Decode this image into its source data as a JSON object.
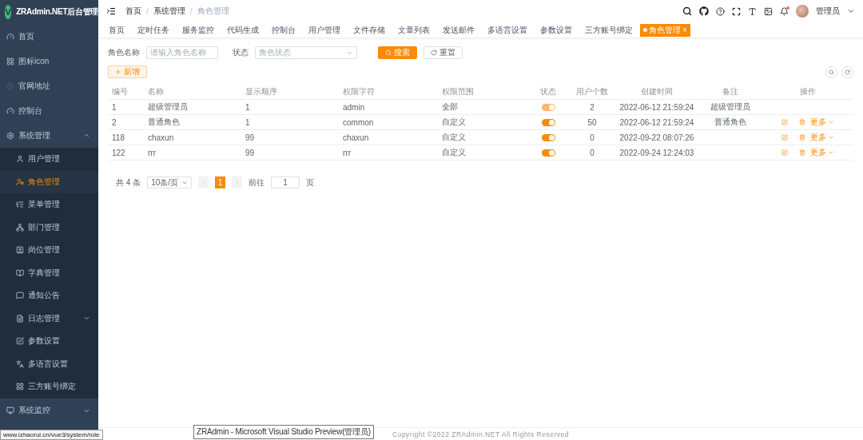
{
  "app": {
    "title": "ZRAdmin.NET后台管理",
    "logo_letter": "V"
  },
  "sidebar": {
    "items": [
      {
        "label": "首页",
        "selected": false
      },
      {
        "label": "图标icon",
        "selected": false
      },
      {
        "label": "官网地址",
        "selected": false
      },
      {
        "label": "控制台",
        "selected": false
      },
      {
        "label": "系统管理",
        "selected": false,
        "expanded": true,
        "children": [
          {
            "label": "用户管理",
            "selected": false
          },
          {
            "label": "角色管理",
            "selected": true
          },
          {
            "label": "菜单管理",
            "selected": false
          },
          {
            "label": "部门管理",
            "selected": false
          },
          {
            "label": "岗位管理",
            "selected": false
          },
          {
            "label": "字典管理",
            "selected": false
          },
          {
            "label": "通知公告",
            "selected": false
          },
          {
            "label": "日志管理",
            "selected": false,
            "expanded": false
          },
          {
            "label": "参数设置",
            "selected": false
          },
          {
            "label": "多语言设置",
            "selected": false
          },
          {
            "label": "三方账号绑定",
            "selected": false
          }
        ]
      },
      {
        "label": "系统监控",
        "selected": false,
        "expanded": false
      }
    ]
  },
  "header": {
    "breadcrumb": [
      "首页",
      "系统管理",
      "角色管理"
    ],
    "breadcrumb_separator": "/",
    "user_name": "管理员",
    "has_notification": true
  },
  "tags": [
    {
      "label": "首页",
      "selected": false
    },
    {
      "label": "定时任务",
      "selected": false
    },
    {
      "label": "服务监控",
      "selected": false
    },
    {
      "label": "代码生成",
      "selected": false
    },
    {
      "label": "控制台",
      "selected": false
    },
    {
      "label": "用户管理",
      "selected": false
    },
    {
      "label": "文件存储",
      "selected": false
    },
    {
      "label": "文章列表",
      "selected": false
    },
    {
      "label": "发送邮件",
      "selected": false
    },
    {
      "label": "多语言设置",
      "selected": false
    },
    {
      "label": "参数设置",
      "selected": false
    },
    {
      "label": "三方账号绑定",
      "selected": false
    },
    {
      "label": "角色管理",
      "selected": true,
      "close_glyph": "×"
    }
  ],
  "search_form": {
    "fields": [
      {
        "kind": "text",
        "label": "角色名称",
        "placeholder": "请输入角色名称"
      },
      {
        "kind": "select",
        "label": "状态",
        "placeholder": "角色状态"
      }
    ],
    "search_button": "搜索",
    "reset_button": "重置"
  },
  "toolbar": {
    "add_button": "新增"
  },
  "table": {
    "columns": [
      "编号",
      "名称",
      "显示顺序",
      "权限字符",
      "权限范围",
      "状态",
      "用户个数",
      "创建时间",
      "备注",
      "操作"
    ],
    "rows": [
      {
        "id": "1",
        "name": "超级管理员",
        "order": "1",
        "key": "admin",
        "scope": "全部",
        "status_on": true,
        "status_disabled": true,
        "users": "2",
        "created": "2022-06-12 21:59:24",
        "remark": "超级管理员"
      },
      {
        "id": "2",
        "name": "普通角色",
        "order": "1",
        "key": "common",
        "scope": "自定义",
        "status_on": true,
        "status_disabled": false,
        "users": "50",
        "created": "2022-06-12 21:59:24",
        "remark": "普通角色",
        "more_label": "更多"
      },
      {
        "id": "118",
        "name": "chaxun",
        "order": "99",
        "key": "chaxun",
        "scope": "自定义",
        "status_on": true,
        "status_disabled": false,
        "users": "0",
        "created": "2022-09-22 08:07:26",
        "more_label": "更多"
      },
      {
        "id": "122",
        "name": "rrr",
        "order": "99",
        "key": "rrr",
        "scope": "自定义",
        "status_on": true,
        "status_disabled": false,
        "users": "0",
        "created": "2022-09-24 12:24:03",
        "more_label": "更多"
      }
    ]
  },
  "pagination": {
    "total": "共 4 条",
    "page_size": "10条/页",
    "pages": [
      {
        "label": "1",
        "selected": true
      }
    ],
    "goto_label": "前往",
    "goto_value": "1",
    "page_suffix": "页"
  },
  "footer": "Copyright ©2022 ZRAdmin.NET All Rights Reserved",
  "browser_status": "www.izhaorui.cn/vue3/system/role",
  "tooltip": "ZRAdmin - Microsoft Visual Studio Preview(管理员)"
}
